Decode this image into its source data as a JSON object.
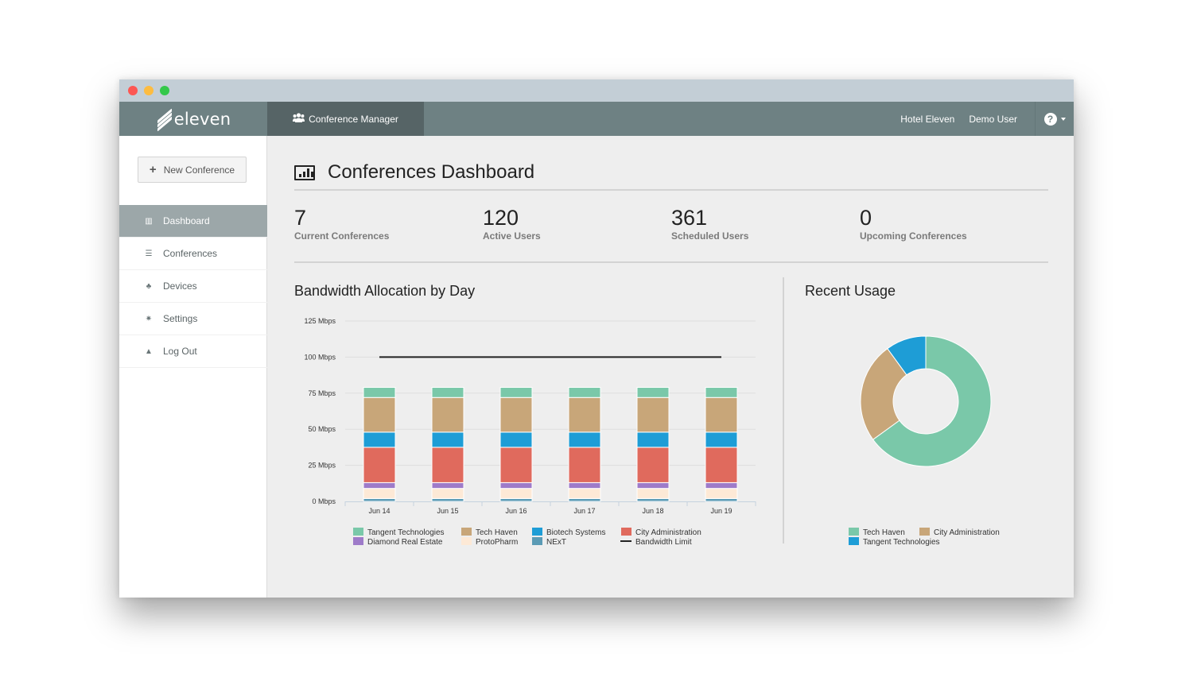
{
  "window": {
    "traffic_lights": [
      "close",
      "minimize",
      "maximize"
    ]
  },
  "navbar": {
    "brand": "eleven",
    "tab_icon": "users-icon",
    "tab_label": "Conference Manager",
    "links": [
      "Hotel Eleven",
      "Demo User"
    ],
    "help_label": "?"
  },
  "sidebar": {
    "new_button": "New Conference",
    "items": [
      {
        "label": "Dashboard",
        "icon": "bar-chart-icon",
        "glyph": "▥",
        "active": true
      },
      {
        "label": "Conferences",
        "icon": "list-icon",
        "glyph": "☰",
        "active": false
      },
      {
        "label": "Devices",
        "icon": "sitemap-icon",
        "glyph": "♣",
        "active": false
      },
      {
        "label": "Settings",
        "icon": "gear-icon",
        "glyph": "✷",
        "active": false
      },
      {
        "label": "Log Out",
        "icon": "lock-icon",
        "glyph": "▲",
        "active": false
      }
    ]
  },
  "main": {
    "title": "Conferences Dashboard",
    "stats": [
      {
        "value": "7",
        "label": "Current Conferences"
      },
      {
        "value": "120",
        "label": "Active Users"
      },
      {
        "value": "361",
        "label": "Scheduled Users"
      },
      {
        "value": "0",
        "label": "Upcoming Conferences"
      }
    ]
  },
  "chart_data": [
    {
      "type": "bar",
      "stacked": true,
      "title": "Bandwidth Allocation by Day",
      "xlabel": "",
      "ylabel": "",
      "categories": [
        "Jun 14",
        "Jun 15",
        "Jun 16",
        "Jun 17",
        "Jun 18",
        "Jun 19"
      ],
      "yticks": [
        "0 Mbps",
        "25 Mbps",
        "50 Mbps",
        "75 Mbps",
        "100 Mbps",
        "125 Mbps"
      ],
      "ylim": [
        0,
        125
      ],
      "grid": true,
      "legend_position": "bottom",
      "series": [
        {
          "name": "NExT",
          "color": "#5b9bb5",
          "values": [
            2,
            2,
            2,
            2,
            2,
            2
          ]
        },
        {
          "name": "ProtoPharm",
          "color": "#fde9d6",
          "values": [
            7,
            7,
            7,
            7,
            7,
            7
          ]
        },
        {
          "name": "Diamond Real Estate",
          "color": "#9e7bc9",
          "values": [
            4,
            4,
            4,
            4,
            4,
            4
          ]
        },
        {
          "name": "City Administration",
          "color": "#e06a5d",
          "values": [
            24.5,
            24.5,
            24.5,
            24.5,
            24.5,
            24.5
          ]
        },
        {
          "name": "Biotech Systems",
          "color": "#1e9dd6",
          "values": [
            10.5,
            10.5,
            10.5,
            10.5,
            10.5,
            10.5
          ]
        },
        {
          "name": "Tech Haven",
          "color": "#c8a679",
          "values": [
            24,
            24,
            24,
            24,
            24,
            24
          ]
        },
        {
          "name": "Tangent Technologies",
          "color": "#7ac8a9",
          "values": [
            7,
            7,
            7,
            7,
            7,
            7
          ]
        }
      ],
      "line": {
        "name": "Bandwidth Limit",
        "color": "#222222",
        "value": 100
      },
      "legend_order": [
        "Tangent Technologies",
        "Tech Haven",
        "Biotech Systems",
        "City Administration",
        "Diamond Real Estate",
        "ProtoPharm",
        "NExT",
        "Bandwidth Limit"
      ]
    },
    {
      "type": "pie",
      "donut": true,
      "title": "Recent Usage",
      "legend_position": "bottom",
      "slices": [
        {
          "name": "Tech Haven",
          "color": "#7ac8a9",
          "value": 65
        },
        {
          "name": "City Administration",
          "color": "#c8a679",
          "value": 25
        },
        {
          "name": "Tangent Technologies",
          "color": "#1e9dd6",
          "value": 10
        }
      ]
    }
  ]
}
